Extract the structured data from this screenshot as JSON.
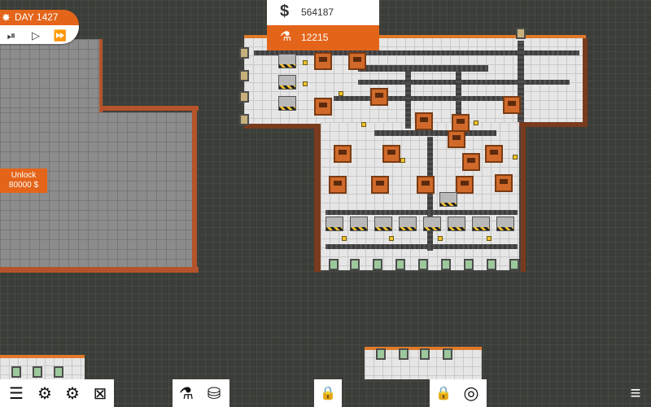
{
  "hud": {
    "day_label": "DAY 1427",
    "money": "564187",
    "research": "12215",
    "money_icon": "dollar-icon",
    "research_icon": "flask-icon",
    "day_icon": "sun-icon"
  },
  "speed_controls": [
    {
      "name": "pause-play-button",
      "glyph": "⏯"
    },
    {
      "name": "play-button",
      "glyph": "▷"
    },
    {
      "name": "fast-forward-button",
      "glyph": "⏩"
    }
  ],
  "unlock": {
    "line1": "Unlock",
    "line2": "80000 $"
  },
  "toolbar": {
    "left": [
      {
        "name": "layers-tool-button",
        "glyph": "☰"
      },
      {
        "name": "settings-tool-button",
        "glyph": "⚙"
      },
      {
        "name": "gears-tool-button",
        "glyph": "⚙"
      },
      {
        "name": "grid-tool-button",
        "glyph": "⊠"
      }
    ],
    "middle": [
      {
        "name": "research-tool-button",
        "glyph": "⚗"
      },
      {
        "name": "database-tool-button",
        "glyph": "⛁"
      }
    ],
    "lock1": {
      "name": "lock-tool-button",
      "glyph": "🔒"
    },
    "right": [
      {
        "name": "lock-tool-button-2",
        "glyph": "🔒"
      },
      {
        "name": "target-tool-button",
        "glyph": "◎"
      }
    ],
    "menu": {
      "name": "menu-button",
      "glyph": "≡"
    }
  },
  "colors": {
    "accent": "#e4651a",
    "floor": "#e6e6e6",
    "locked": "#8c8c8c",
    "background": "#3b3d38"
  }
}
